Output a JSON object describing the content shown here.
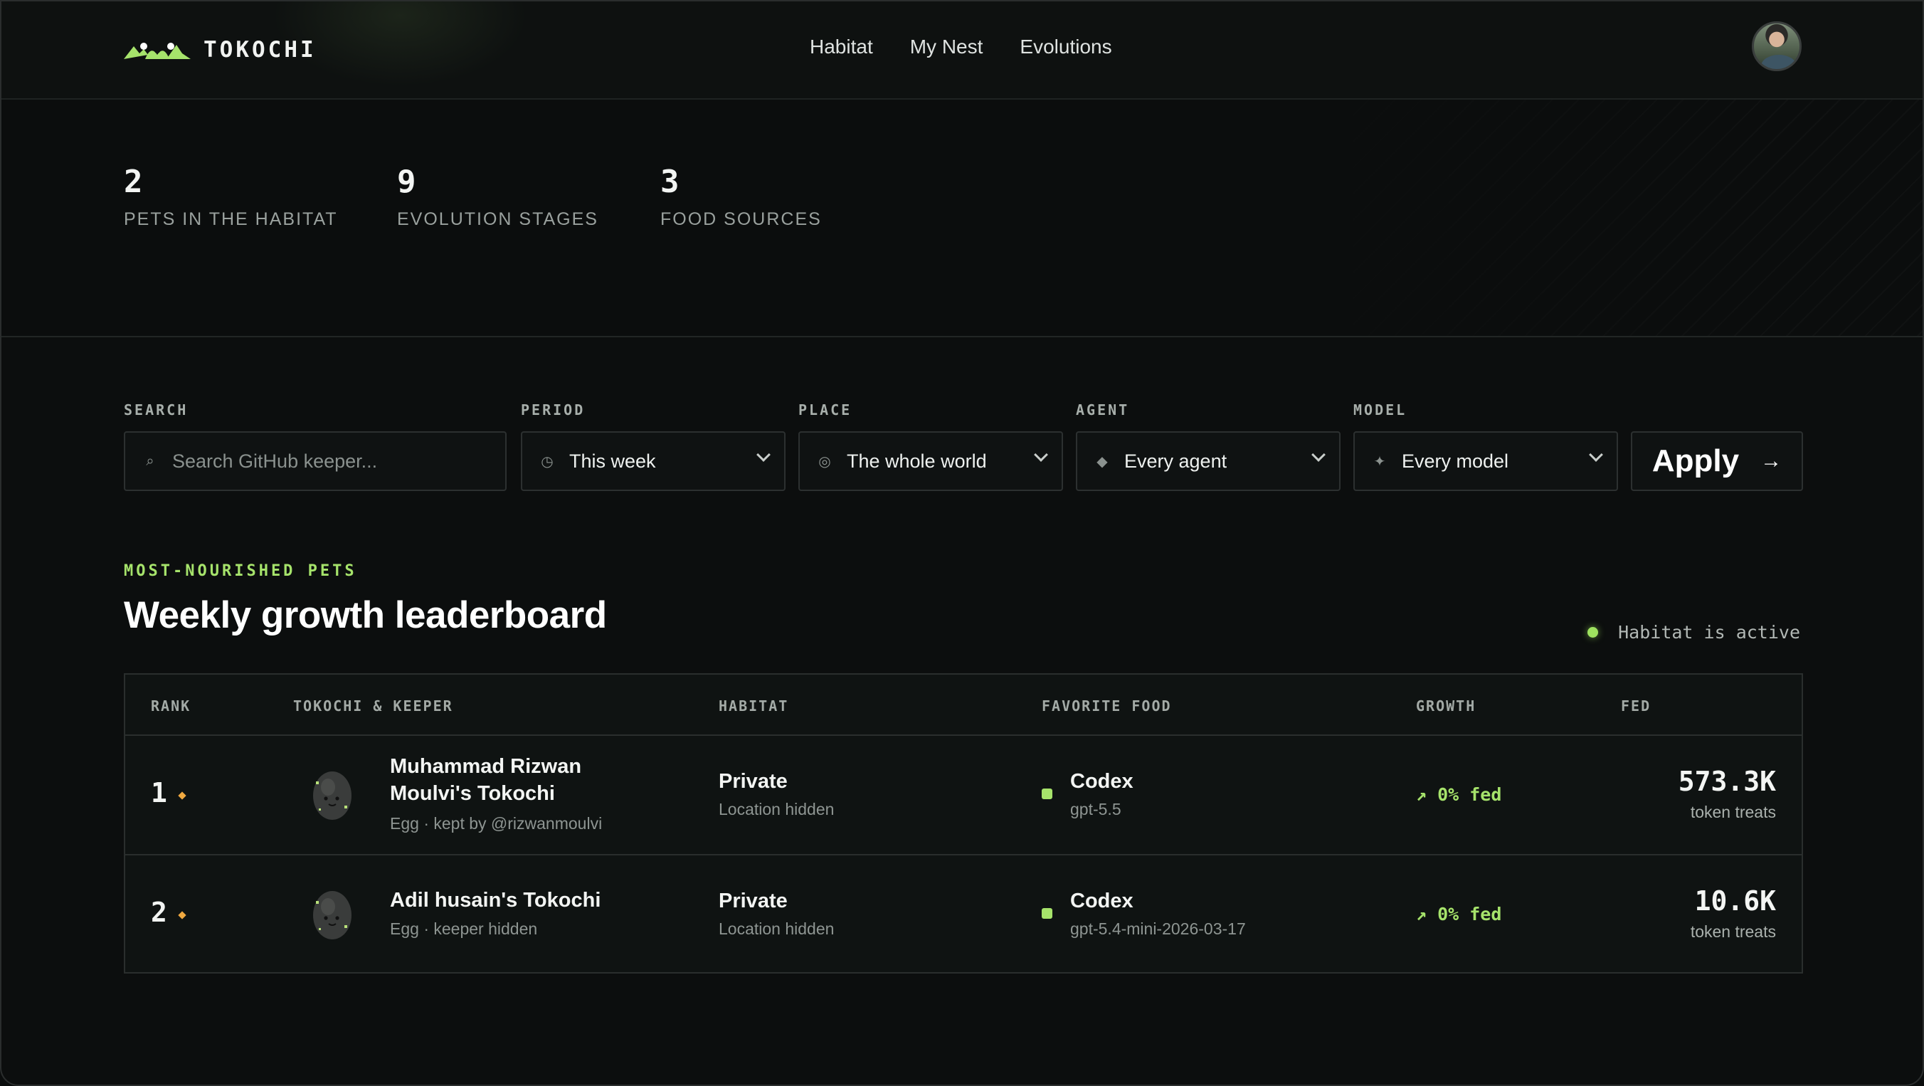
{
  "brand": {
    "name": "TOKOCHI"
  },
  "nav": {
    "items": [
      "Habitat",
      "My Nest",
      "Evolutions"
    ]
  },
  "stats": [
    {
      "value": "2",
      "label": "PETS IN THE HABITAT"
    },
    {
      "value": "9",
      "label": "EVOLUTION STAGES"
    },
    {
      "value": "3",
      "label": "FOOD SOURCES"
    }
  ],
  "filters": {
    "search": {
      "label": "SEARCH",
      "placeholder": "Search GitHub keeper...",
      "icon": "search-icon"
    },
    "period": {
      "label": "PERIOD",
      "value": "This week",
      "icon": "clock-icon"
    },
    "place": {
      "label": "PLACE",
      "value": "The whole world",
      "icon": "globe-icon"
    },
    "agent": {
      "label": "AGENT",
      "value": "Every agent",
      "icon": "diamond-icon"
    },
    "model": {
      "label": "MODEL",
      "value": "Every model",
      "icon": "sparkle-icon"
    },
    "apply": {
      "label": "Apply",
      "arrow": "→"
    }
  },
  "section": {
    "eyebrow": "MOST-NOURISHED PETS",
    "title": "Weekly growth leaderboard",
    "status": "Habitat is active"
  },
  "table": {
    "columns": [
      "RANK",
      "TOKOCHI & KEEPER",
      "HABITAT",
      "FAVORITE FOOD",
      "GROWTH",
      "FED"
    ],
    "rows": [
      {
        "rank": "1",
        "name": "Muhammad Rizwan Moulvi's Tokochi",
        "sub": "Egg · kept by @rizwanmoulvi",
        "habitat": "Private",
        "habitat_sub": "Location hidden",
        "food": "Codex",
        "model": "gpt-5.5",
        "growth": "↗ 0% fed",
        "fed": "573.3K",
        "fed_unit": "token treats"
      },
      {
        "rank": "2",
        "name": "Adil husain's Tokochi",
        "sub": "Egg · keeper hidden",
        "habitat": "Private",
        "habitat_sub": "Location hidden",
        "food": "Codex",
        "model": "gpt-5.4-mini-2026-03-17",
        "growth": "↗ 0% fed",
        "fed": "10.6K",
        "fed_unit": "token treats"
      }
    ]
  },
  "colors": {
    "accent": "#a6e36b",
    "rank_marker": "#f0a940",
    "background": "#0c0e0e"
  }
}
